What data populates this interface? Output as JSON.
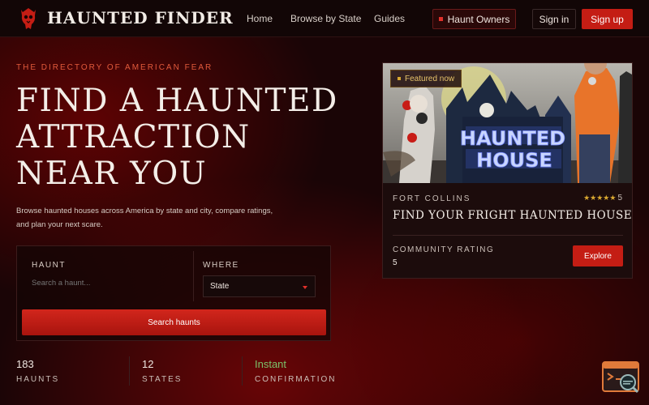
{
  "header": {
    "brand": "HAUNTED FINDER",
    "nav": [
      "Home",
      "Browse by State",
      "Guides"
    ],
    "owners_label": "Haunt Owners",
    "signin_label": "Sign in",
    "signup_label": "Sign up"
  },
  "hero": {
    "eyebrow": "THE DIRECTORY OF AMERICAN FEAR",
    "title": "FIND A HAUNTED ATTRACTION NEAR YOU",
    "description": "Browse haunted houses across America by state and city, compare ratings, and plan your next scare."
  },
  "search": {
    "haunt_label": "HAUNT",
    "haunt_placeholder": "Search a haunt...",
    "where_label": "WHERE",
    "where_value": "State",
    "button_label": "Search haunts"
  },
  "stats": [
    {
      "value": "183",
      "label": "HAUNTS"
    },
    {
      "value": "12",
      "label": "STATES"
    },
    {
      "value": "Instant",
      "label": "CONFIRMATION"
    }
  ],
  "featured": {
    "badge": "Featured now",
    "image_sign_line1": "HAUNTED",
    "image_sign_line2": "HOUSE",
    "city": "FORT COLLINS",
    "stars": "★★★★★",
    "rating": "5",
    "title": "FIND YOUR FRIGHT HAUNTED HOUSE",
    "rating_label": "COMMUNITY RATING",
    "rating_value": "5",
    "button_label": "Explore"
  },
  "colors": {
    "accent_red": "#c41d14",
    "eyebrow": "#e25a3c",
    "gold": "#d9a830",
    "green": "#7ac26a",
    "background": "#1a0506"
  },
  "icons": {
    "logo": "demon-skull-icon",
    "corner_widget": "search-document-icon"
  }
}
